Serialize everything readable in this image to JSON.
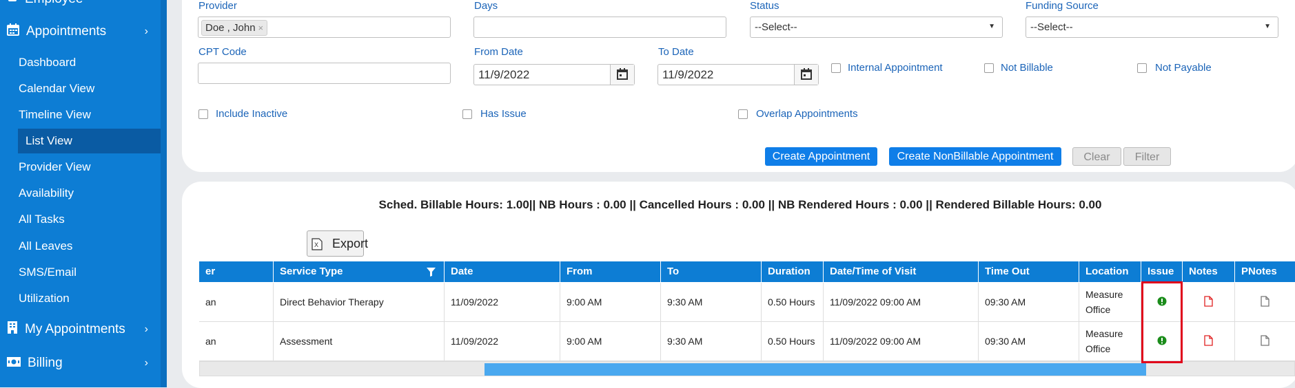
{
  "sidebar": {
    "top_item": "Employee",
    "appointments": {
      "label": "Appointments"
    },
    "items": [
      {
        "label": "Dashboard"
      },
      {
        "label": "Calendar View"
      },
      {
        "label": "Timeline View"
      },
      {
        "label": "List View",
        "active": true
      },
      {
        "label": "Provider View"
      },
      {
        "label": "Availability"
      },
      {
        "label": "All Tasks"
      },
      {
        "label": "All Leaves"
      },
      {
        "label": "SMS/Email"
      },
      {
        "label": "Utilization"
      }
    ],
    "my_appointments": "My Appointments",
    "billing": "Billing",
    "accent": "#0d7dd4",
    "active_bg": "#0a5ba3"
  },
  "filters": {
    "provider": {
      "label": "Provider",
      "tag": "Doe , John",
      "tag_close": "×"
    },
    "days": {
      "label": "Days",
      "value": ""
    },
    "status": {
      "label": "Status",
      "value": "--Select--"
    },
    "funding_source": {
      "label": "Funding Source",
      "value": "--Select--"
    },
    "cpt_code": {
      "label": "CPT Code",
      "value": ""
    },
    "from_date": {
      "label": "From Date",
      "value": "11/9/2022"
    },
    "to_date": {
      "label": "To Date",
      "value": "11/9/2022"
    },
    "checkboxes": {
      "internal": "Internal Appointment",
      "not_billable": "Not Billable",
      "not_payable": "Not Payable",
      "include_inactive": "Include Inactive",
      "has_issue": "Has Issue",
      "overlap": "Overlap Appointments"
    },
    "buttons": {
      "create": "Create Appointment",
      "create_nb": "Create NonBillable Appointment",
      "clear": "Clear",
      "filter": "Filter"
    }
  },
  "results": {
    "summary": "Sched. Billable Hours: 1.00|| NB Hours : 0.00 || Cancelled Hours : 0.00 || NB Rendered Hours : 0.00 || Rendered Billable Hours: 0.00",
    "export_label": "Export",
    "columns": [
      "er",
      "Service Type",
      "Date",
      "From",
      "To",
      "Duration",
      "Date/Time of Visit",
      "Time Out",
      "Location",
      "Issue",
      "Notes",
      "PNotes"
    ],
    "rows": [
      {
        "c0": "an",
        "service": "Direct Behavior Therapy",
        "date": "11/09/2022",
        "from": "9:00 AM",
        "to": "9:30 AM",
        "duration": "0.50 Hours",
        "visit": "11/09/2022 09:00 AM",
        "time_out": "09:30 AM",
        "location": "Measure Office"
      },
      {
        "c0": "an",
        "service": "Assessment",
        "date": "11/09/2022",
        "from": "9:00 AM",
        "to": "9:30 AM",
        "duration": "0.50 Hours",
        "visit": "11/09/2022 09:00 AM",
        "time_out": "09:30 AM",
        "location": "Measure Office"
      }
    ],
    "issue_icon": "exclamation-circle-green",
    "notes_icon": "file-red",
    "pnotes_icon": "file-gray",
    "header_color": "#0d7dd4",
    "highlight_color": "#e0001b"
  }
}
